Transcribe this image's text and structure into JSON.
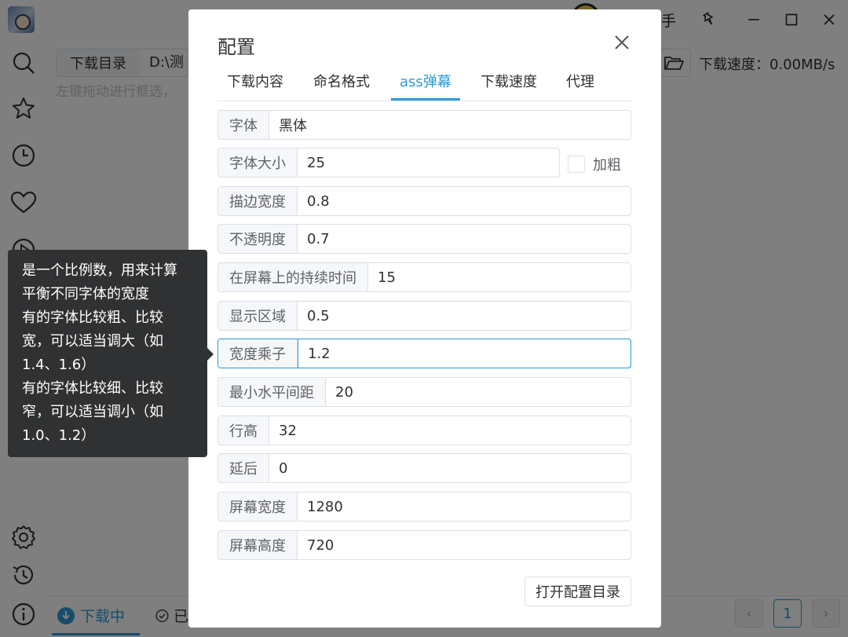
{
  "app": {
    "title_partial": "手",
    "toolbar": {
      "download_dir_label": "下载目录",
      "download_dir_value": "D:\\测",
      "hint": "左键拖动进行框选，",
      "speed": "下载速度：0.00MB/s"
    },
    "bottom": {
      "tab_downloading": "下载中",
      "tab_done": "已",
      "current_page": "1",
      "prev": "‹",
      "next": "›"
    },
    "sidebar_icons": [
      "search-icon",
      "star-icon",
      "clock-icon",
      "heart-icon",
      "play-icon",
      "settings-icon",
      "history-icon",
      "info-icon"
    ]
  },
  "dialog": {
    "title": "配置",
    "tabs": [
      "下载内容",
      "命名格式",
      "ass弹幕",
      "下载速度",
      "代理"
    ],
    "active_tab": "ass弹幕",
    "fields": [
      {
        "label": "字体",
        "value": "黑体"
      },
      {
        "label": "字体大小",
        "value": "25"
      },
      {
        "label": "描边宽度",
        "value": "0.8"
      },
      {
        "label": "不透明度",
        "value": "0.7"
      },
      {
        "label": "在屏幕上的持续时间",
        "value": "15"
      },
      {
        "label": "显示区域",
        "value": "0.5"
      },
      {
        "label": "宽度乘子",
        "value": "1.2"
      },
      {
        "label": "最小水平间距",
        "value": "20"
      },
      {
        "label": "行高",
        "value": "32"
      },
      {
        "label": "延后",
        "value": "0"
      },
      {
        "label": "屏幕宽度",
        "value": "1280"
      },
      {
        "label": "屏幕高度",
        "value": "720"
      }
    ],
    "bold_label": "加粗",
    "bold_checked": false,
    "open_config_dir": "打开配置目录"
  },
  "tooltip": {
    "lines": [
      "是一个比例数，用来计算",
      "平衡不同字体的宽度",
      "有的字体比较粗、比较",
      "宽，可以适当调大（如",
      "1.4、1.6）",
      "有的字体比较细、比较",
      "窄，可以适当调小（如",
      "1.0、1.2）"
    ]
  },
  "colors": {
    "accent": "#2a9ad6",
    "tooltip_bg": "#303133",
    "mask": "rgba(0,0,0,0.5)"
  }
}
